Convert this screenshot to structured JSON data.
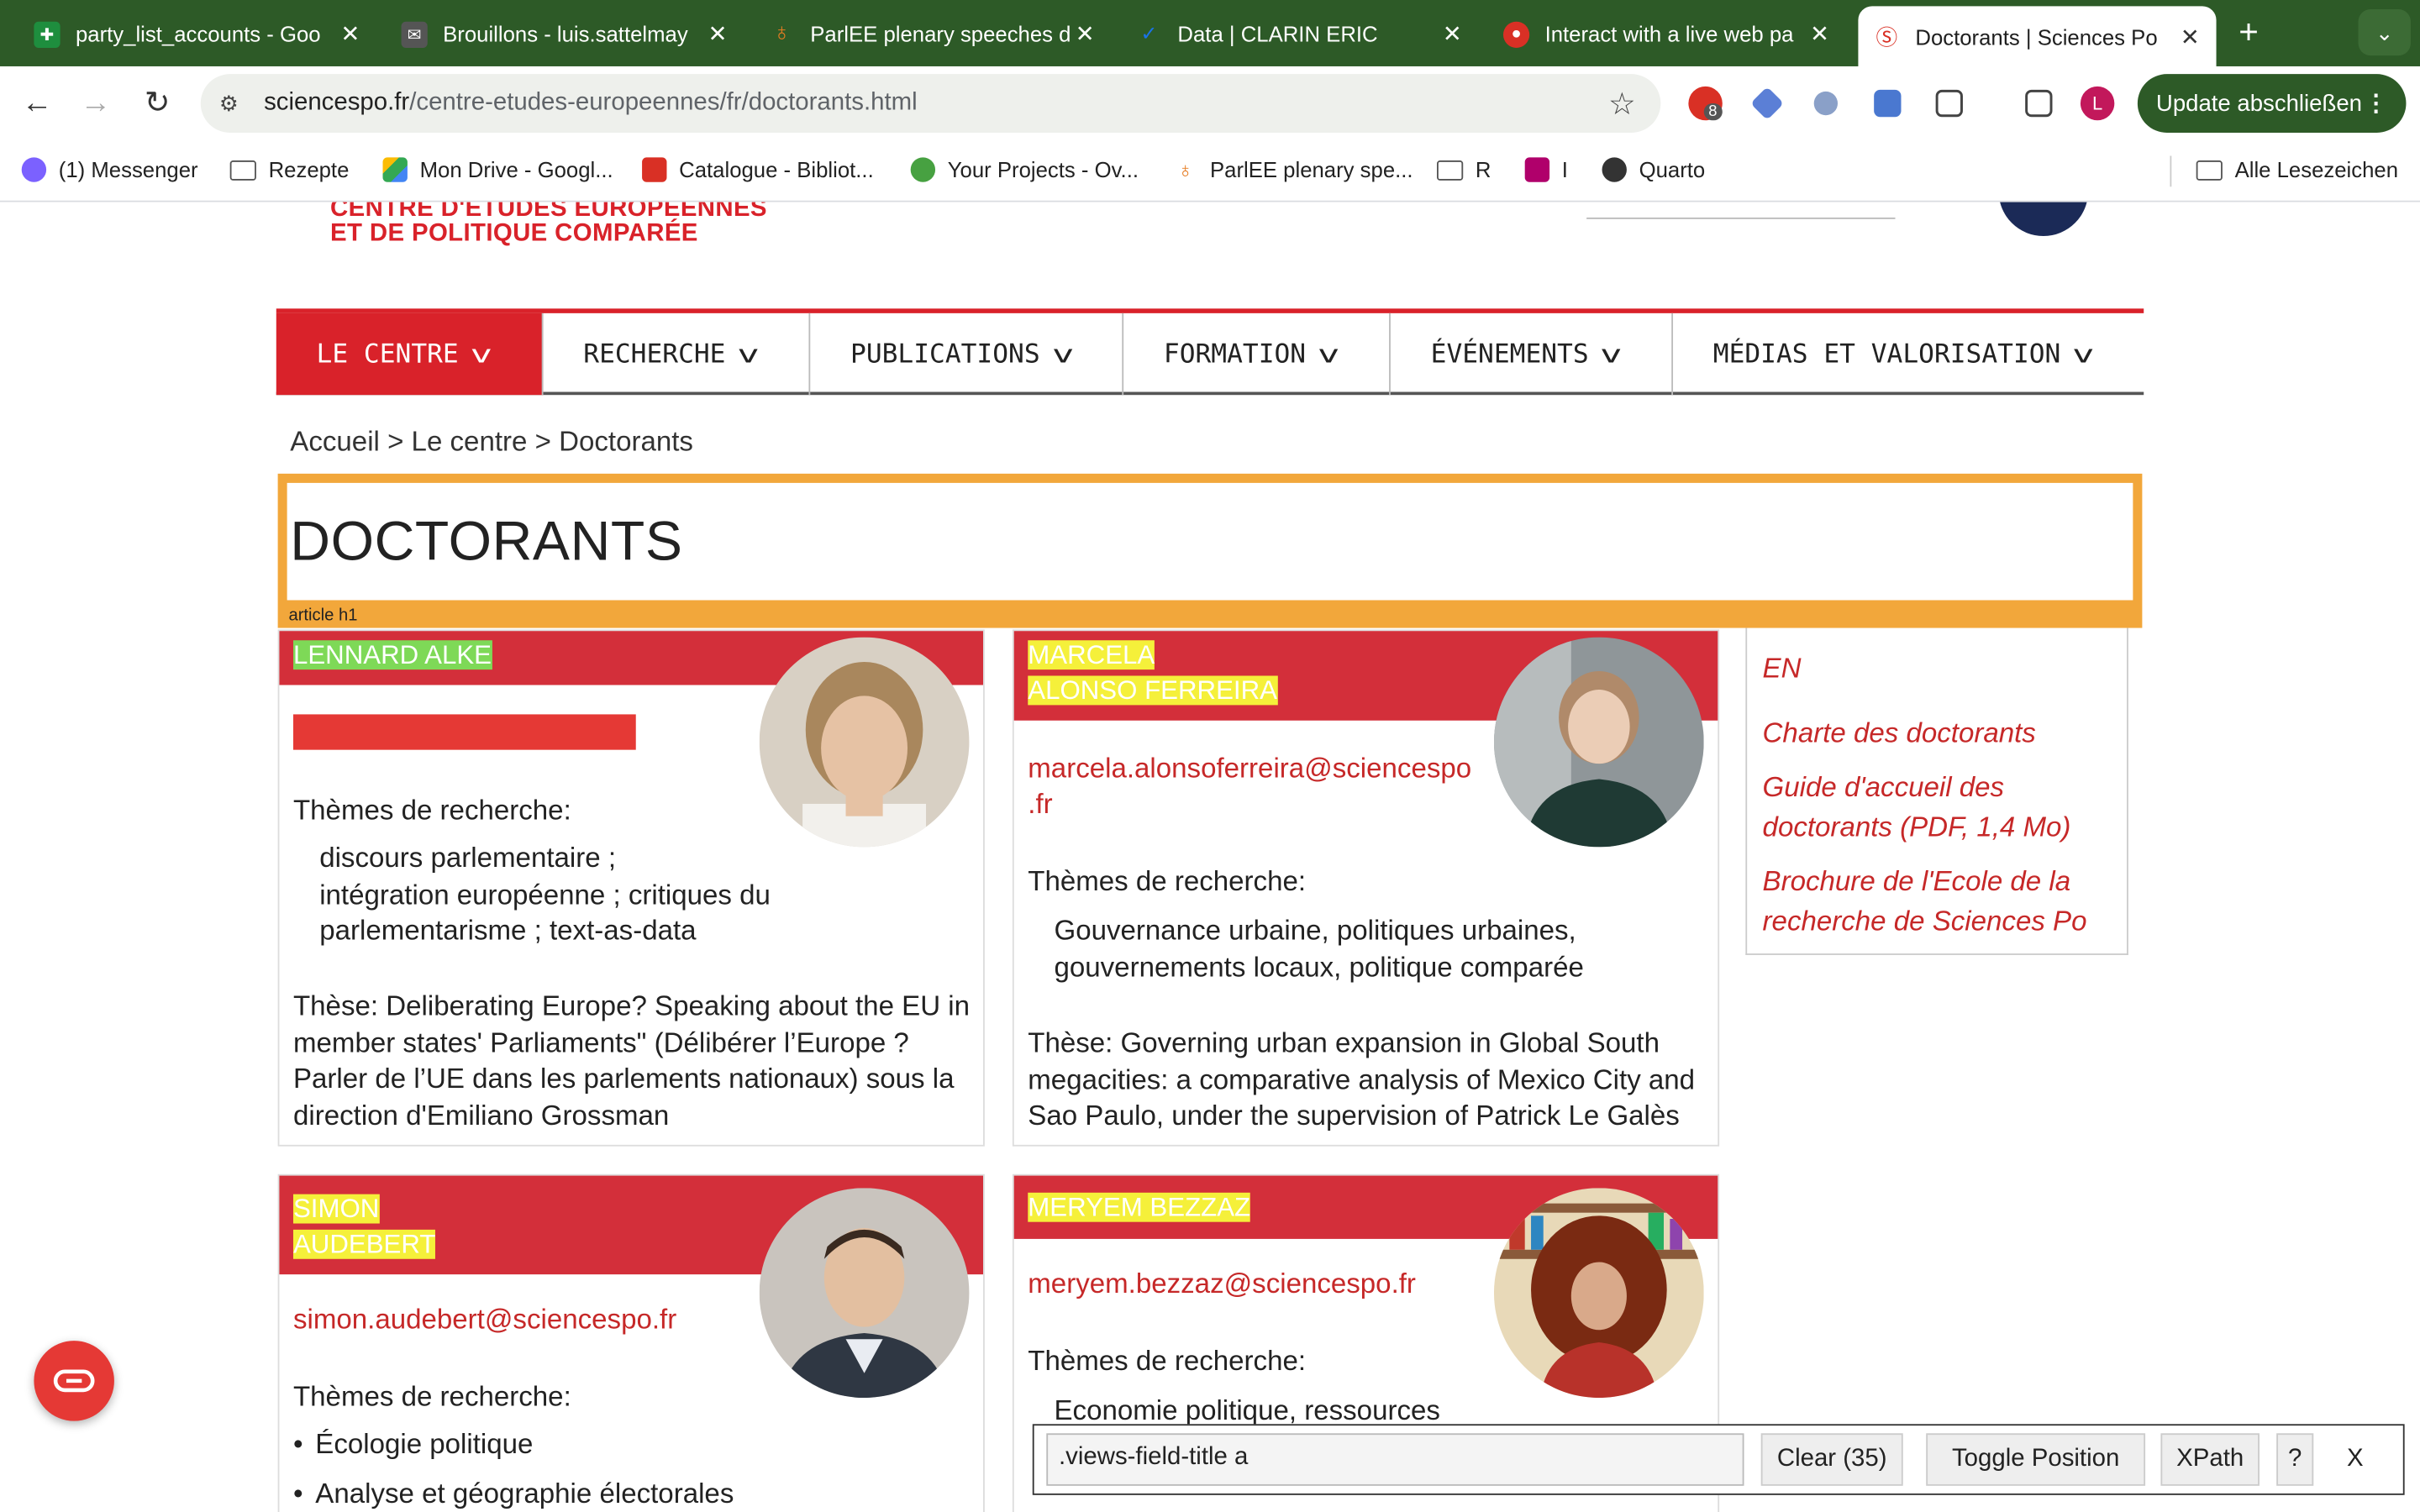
{
  "browser": {
    "tabs": [
      {
        "title": "party_list_accounts - Goo",
        "icon_color": "#1e8e3e"
      },
      {
        "title": "Brouillons - luis.sattelmay",
        "icon_color": "#555"
      },
      {
        "title": "ParlEE plenary speeches d",
        "icon_color": "#e67c22"
      },
      {
        "title": "Data | CLARIN ERIC",
        "icon_color": "#1a73e8"
      },
      {
        "title": "Interact with a live web pa",
        "icon_color": "#d93025"
      },
      {
        "title": "Doctorants | Sciences Po",
        "icon_color": "#d93025"
      }
    ],
    "new_tab": "+",
    "url_domain": "sciencespo.fr",
    "url_path": "/centre-etudes-europeennes/fr/doctorants.html",
    "extension_badge": "8",
    "profile_initial": "L",
    "update_button": "Update abschließen",
    "bookmarks": [
      {
        "label": "(1) Messenger",
        "icon": "messenger-icon"
      },
      {
        "label": "Rezepte",
        "icon": "folder-icon"
      },
      {
        "label": "Mon Drive - Googl...",
        "icon": "drive-icon"
      },
      {
        "label": "Catalogue - Bibliot...",
        "icon": "library-icon"
      },
      {
        "label": "Your Projects - Ov...",
        "icon": "overleaf-icon"
      },
      {
        "label": "ParlEE plenary spe...",
        "icon": "parlee-icon"
      },
      {
        "label": "R",
        "icon": "folder-icon"
      },
      {
        "label": "I",
        "icon": "site-icon"
      },
      {
        "label": "Quarto",
        "icon": "globe-icon"
      }
    ],
    "all_bookmarks": "Alle Lesezeichen"
  },
  "site": {
    "logo_line1": "CENTRE D'ÉTUDES EUROPÉENNES",
    "logo_line2": "ET DE POLITIQUE COMPARÉE",
    "nav": [
      "LE CENTRE",
      "RECHERCHE",
      "PUBLICATIONS",
      "FORMATION",
      "ÉVÉNEMENTS",
      "MÉDIAS ET VALORISATION"
    ],
    "breadcrumb": "Accueil > Le centre > Doctorants",
    "page_title": "DOCTORANTS",
    "highlight_label": "article h1"
  },
  "cards": [
    {
      "name": "LENNARD ALKE",
      "email": "",
      "themes_label": "Thèmes de recherche:",
      "themes": [
        "discours parlementaire ;",
        "intégration européenne ; critiques du",
        "parlementarisme ; text-as-data"
      ],
      "these": "Thèse: Deliberating Europe? Speaking about the EU in member states' Parliaments\" (Délibérer l’Europe ? Parler de l’UE dans les parlements nationaux) sous la direction d'Emiliano Grossman"
    },
    {
      "name_l1": "MARCELA",
      "name_l2": "ALONSO FERREIRA",
      "email_l1": "marcela.alonsoferreira@sciencespo",
      "email_l2": ".fr",
      "themes_label": "Thèmes de recherche:",
      "themes": [
        "Gouvernance urbaine, politiques urbaines,",
        "gouvernements locaux, politique comparée"
      ],
      "these": "Thèse: Governing urban expansion in Global South megacities: a comparative analysis of Mexico City and Sao Paulo, under the supervision of Patrick Le Galès"
    },
    {
      "name_l1": "SIMON",
      "name_l2": "AUDEBERT",
      "email": "simon.audebert@sciencespo.fr",
      "themes_label": "Thèmes de recherche:",
      "themes": [
        "Écologie politique",
        "Analyse et géographie électorales"
      ]
    },
    {
      "name": "MERYEM BEZZAZ",
      "email": "meryem.bezzaz@sciencespo.fr",
      "themes_label": "Thèmes de recherche:",
      "themes": [
        "Economie politique, ressources"
      ]
    }
  ],
  "sidebar": {
    "lang": "EN",
    "links": [
      "Charte des doctorants",
      "Guide d'accueil des doctorants (PDF, 1,4 Mo)",
      "Brochure de l'Ecole de la recherche de Sciences Po"
    ]
  },
  "selector_tool": {
    "query": ".views-field-title a",
    "clear": "Clear (35)",
    "toggle": "Toggle Position",
    "xpath": "XPath",
    "help": "?",
    "close": "X"
  }
}
